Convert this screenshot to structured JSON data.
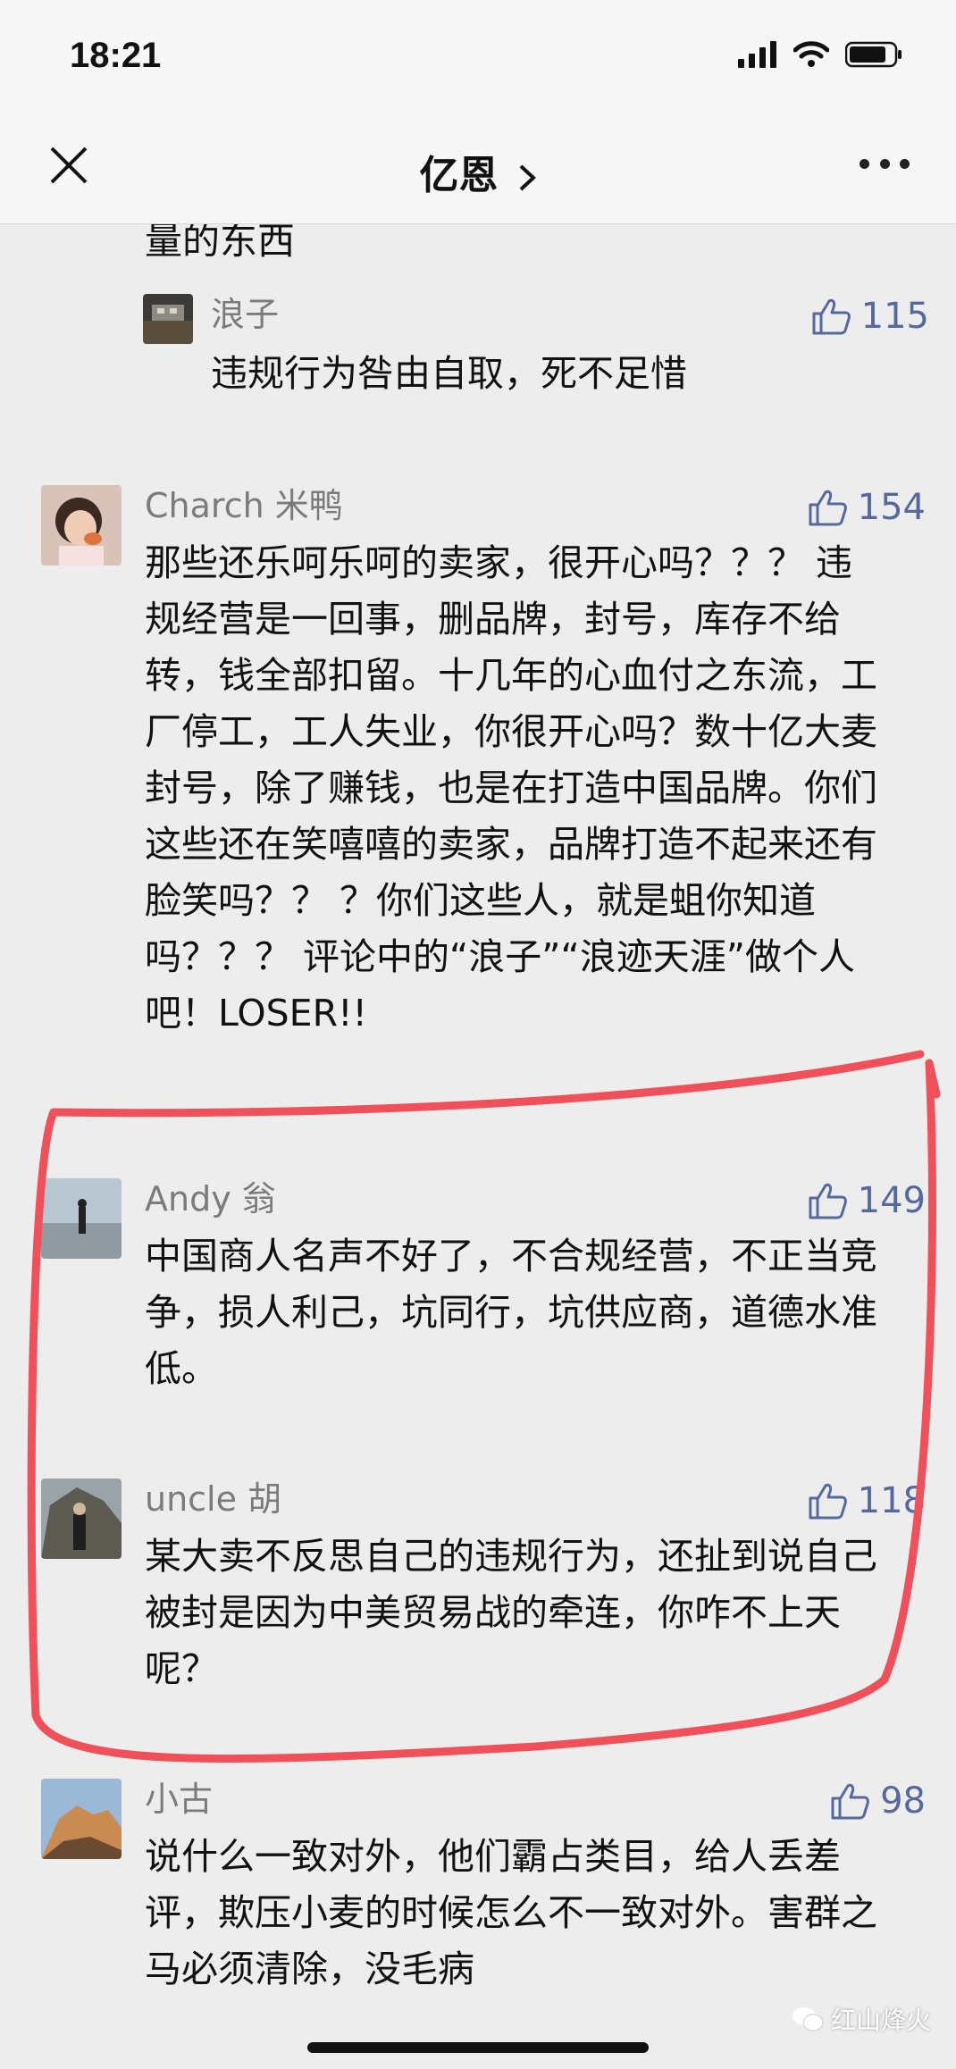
{
  "status_bar": {
    "time": "18:21"
  },
  "nav": {
    "title": "亿恩"
  },
  "top_fragment": "量的东西",
  "reply": {
    "name": "浪子",
    "likes": "115",
    "text": "违规行为咎由自取，死不足惜"
  },
  "comments": [
    {
      "name": "Charch 米鸭",
      "likes": "154",
      "text": "那些还乐呵乐呵的卖家，很开心吗？？？  违规经营是一回事，删品牌，封号，库存不给转，钱全部扣留。十几年的心血付之东流，工厂停工，工人失业，你很开心吗？数十亿大麦封号，除了赚钱，也是在打造中国品牌。你们这些还在笑嘻嘻的卖家，品牌打造不起来还有脸笑吗？？ ？你们这些人，就是蛆你知道吗？？？ 评论中的“浪子”“浪迹天涯”做个人吧！LOSER!!"
    },
    {
      "name": "Andy 翁",
      "likes": "149",
      "text": "中国商人名声不好了，不合规经营，不正当竞争，损人利己，坑同行，坑供应商，道德水准低。"
    },
    {
      "name": "uncle 胡",
      "likes": "118",
      "text": "某大卖不反思自己的违规行为，还扯到说自己被封是因为中美贸易战的牵连，你咋不上天呢？"
    },
    {
      "name": "小古",
      "likes": "98",
      "text": "说什么一致对外，他们霸占类目，给人丢差评，欺压小麦的时候怎么不一致对外。害群之马必须清除，没毛病"
    }
  ],
  "watermark": "红山烽火",
  "colors": {
    "like_blue": "#56699e",
    "annotation_red": "#f0505a"
  }
}
